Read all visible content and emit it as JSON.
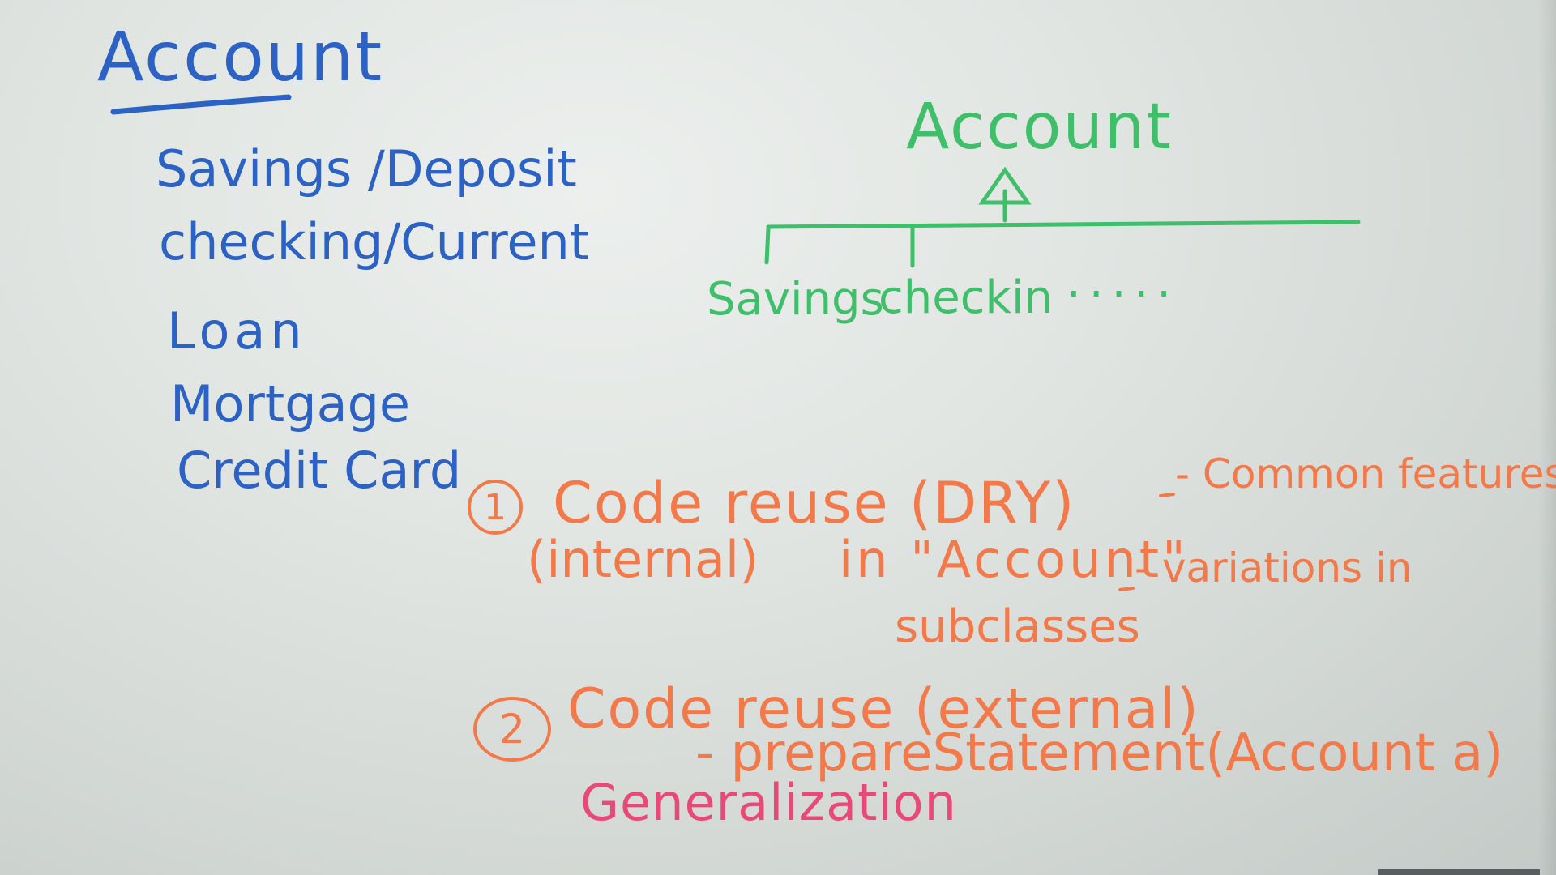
{
  "left_column": {
    "title": "Account",
    "items": [
      "Savings /Deposit",
      "checking/Current",
      "Loan",
      "Mortgage",
      "Credit Card"
    ]
  },
  "hierarchy": {
    "root": "Account",
    "children": [
      "Savings",
      "checkin",
      "....."
    ]
  },
  "notes": {
    "point1": {
      "marker": "1",
      "line_a": "Code reuse (DRY)",
      "line_b": "- Common features",
      "line_c": "(internal)",
      "line_d": "in \"Account\"",
      "line_e": "- variations in",
      "line_f": "subclasses"
    },
    "point2": {
      "marker": "2",
      "line_a": "Code reuse (external)",
      "line_b": "- prepareStatement(Account a)"
    },
    "footer": "Generalization"
  },
  "colors": {
    "board": "#e2e6e3",
    "blue_marker": "#2c62c4",
    "green_marker": "#3fbf6a",
    "orange_marker": "#f2794a",
    "pink_marker": "#e84a78"
  }
}
